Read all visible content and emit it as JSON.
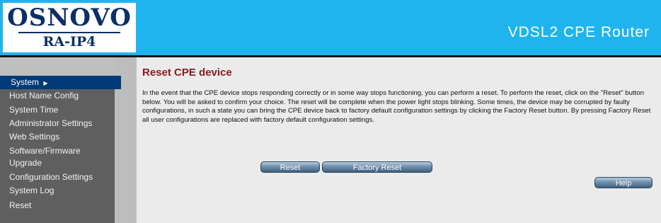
{
  "header": {
    "logo_main": "OSNOVO",
    "logo_sub": "RA-IP4",
    "product_title": "VDSL2 CPE Router"
  },
  "sidebar": {
    "section_label": "System",
    "items": [
      "Host Name Config",
      "System Time",
      "Administrator Settings",
      "Web Settings",
      "Software/Firmware",
      "Upgrade",
      "Configuration Settings",
      "System Log",
      "Reset"
    ]
  },
  "main": {
    "title": "Reset CPE device",
    "description": "In the event that the CPE device stops responding correctly or in some way stops functioning, you can perform a reset. To perform the reset, click on the \"Reset\" button below. You will be asked to confirm your choice. The reset will be complete when the power light stops blinking. Some times, the device may be corrupted by faulty configurations, in such a state you can bring the CPE device back to factory default configuration settings by clicking the Factory Reset button. By pressing Factory Reset all user configurations are replaced with factory default configuration settings.",
    "reset_label": "Reset",
    "factory_reset_label": "Factory Reset",
    "help_label": "Help"
  },
  "colors": {
    "header_bg": "#1fb4ee",
    "nav_active": "#003a78",
    "sidebar_bg": "#5f5f5f",
    "title_red": "#8a1a1a"
  },
  "icons": {
    "system_arrow": "caret-right-icon"
  }
}
